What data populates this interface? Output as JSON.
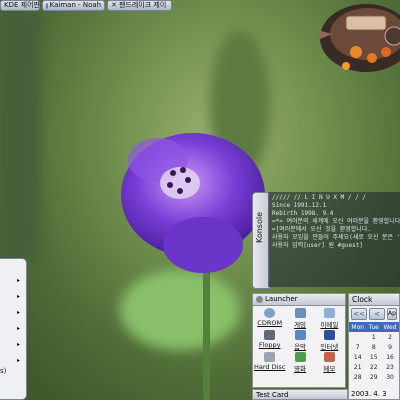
{
  "taskbar": {
    "items": [
      {
        "label": "KDE 제어판"
      },
      {
        "label": "Kaiman - Noah"
      },
      {
        "label": "팬드레이크 제이"
      }
    ]
  },
  "konsole": {
    "tab_label": "Konsole",
    "lines": [
      "/////     // L I N U X  M / / /",
      "",
      "                        Since  1991.12.1",
      "                     Rebirth 1998. 9.4",
      "",
      "=*= 여러분의 세계에 오신 여러분을 환영합니다",
      "",
      "=[여러분에서 오신 것을 환영합니다.",
      "",
      "사용자 모임을 만들어 주세요(새로 오신 분은 'new'를",
      "사용자 입력[user] 원 #guest]"
    ]
  },
  "launcher": {
    "title": "Launcher",
    "apps": [
      {
        "label": "CDROM",
        "color": "#7fa0c8"
      },
      {
        "label": "게임",
        "color": "#6c8fb8"
      },
      {
        "label": "이메일",
        "color": "#8fb0d4"
      },
      {
        "label": "Floppy",
        "color": "#5f6a78"
      },
      {
        "label": "음악",
        "color": "#5b86c6"
      },
      {
        "label": "인터넷",
        "color": "#2c4f9a"
      },
      {
        "label": "Hard Disc",
        "color": "#9aa4b0"
      },
      {
        "label": "영화",
        "color": "#4f9a4f"
      },
      {
        "label": "메모",
        "color": "#c8614a"
      }
    ]
  },
  "clock": {
    "title": "Clock",
    "month_label": "Ap",
    "prev_label": "<<",
    "prev2_label": "<",
    "weekdays": [
      "Mon",
      "Tue",
      "Wed"
    ],
    "weeks": [
      [
        "",
        "1",
        "2"
      ],
      [
        "7",
        "8",
        "9"
      ],
      [
        "14",
        "15",
        "16"
      ],
      [
        "21",
        "22",
        "23"
      ],
      [
        "28",
        "29",
        "30"
      ]
    ],
    "date": "2003. 4. 3"
  },
  "testcard": {
    "label": "Test Card"
  },
  "leftmenu": {
    "cut_text": "s)"
  },
  "colors": {
    "accent": "#3d6db8",
    "panel_bg": "#f2f2f4"
  }
}
